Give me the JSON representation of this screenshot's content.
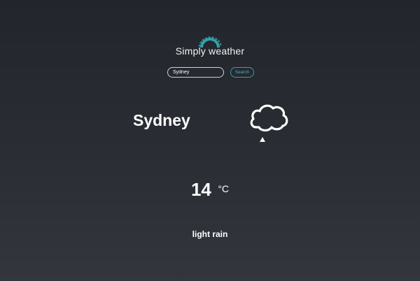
{
  "app": {
    "title": "Simply weather",
    "logo_icon": "sun-icon",
    "accent_color": "#33a2a7"
  },
  "search": {
    "value": "Sydney",
    "button_label": "Search"
  },
  "weather": {
    "city": "Sydney",
    "icon": "rain-cloud-icon",
    "temperature": "14",
    "unit": "°C",
    "description": "light rain"
  }
}
